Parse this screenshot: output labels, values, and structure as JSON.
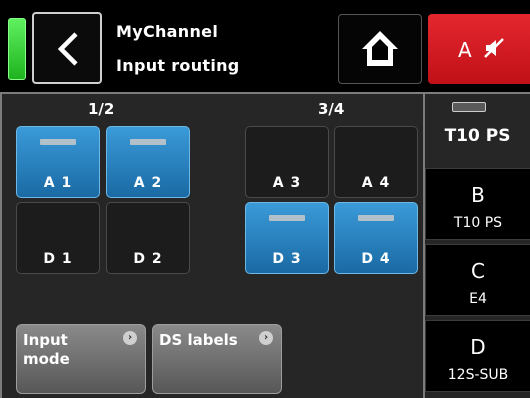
{
  "header": {
    "title": "MyChannel",
    "subtitle": "Input routing",
    "mute_label": "A",
    "status_color": "#2ecc2e",
    "mute_color": "#d81e25"
  },
  "groups": [
    {
      "label": "1/2"
    },
    {
      "label": "3/4"
    }
  ],
  "inputs": [
    {
      "label": "A 1",
      "active": true
    },
    {
      "label": "A 2",
      "active": true
    },
    {
      "label": "A 3",
      "active": false
    },
    {
      "label": "A 4",
      "active": false
    },
    {
      "label": "D 1",
      "active": false
    },
    {
      "label": "D 2",
      "active": false
    },
    {
      "label": "D 3",
      "active": true
    },
    {
      "label": "D 4",
      "active": true
    }
  ],
  "buttons": {
    "input_mode": "Input\nmode",
    "ds_labels": "DS labels"
  },
  "amplifier": {
    "name": "T10 PS"
  },
  "channels": [
    {
      "letter": "B",
      "name": "T10 PS"
    },
    {
      "letter": "C",
      "name": "E4"
    },
    {
      "letter": "D",
      "name": "12S-SUB"
    }
  ]
}
